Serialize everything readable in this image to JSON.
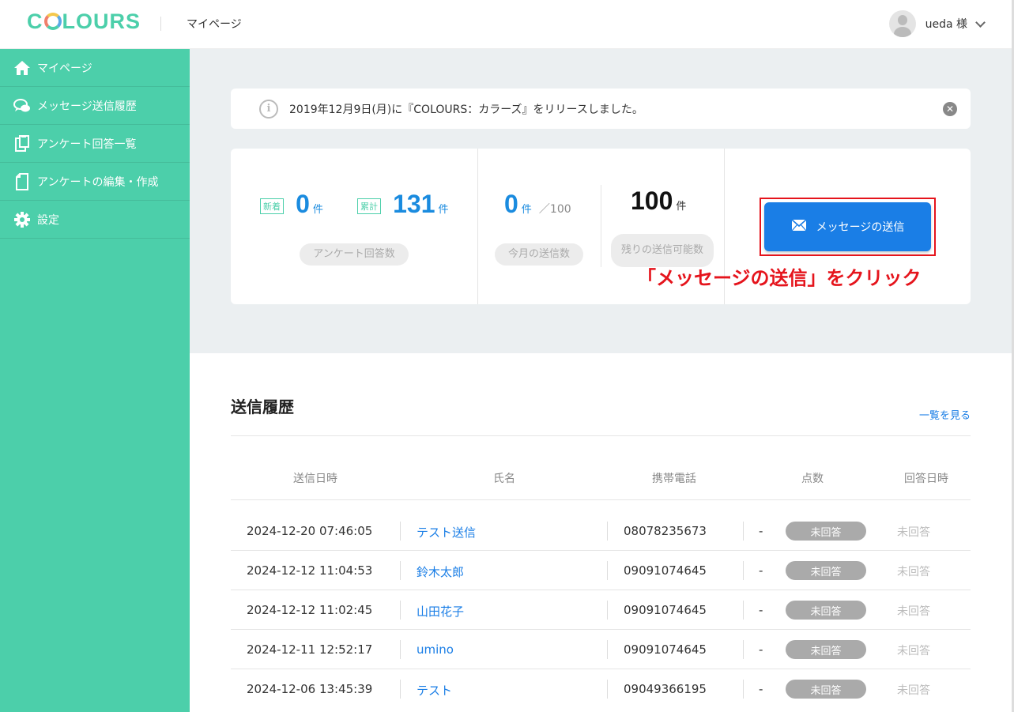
{
  "header": {
    "logo": "COLOURS",
    "title": "マイページ",
    "user": "ueda 様"
  },
  "sidebar": {
    "items": [
      {
        "label": "マイページ",
        "icon": "home-icon"
      },
      {
        "label": "メッセージ送信履歴",
        "icon": "chat-icon"
      },
      {
        "label": "アンケート回答一覧",
        "icon": "clipboard-icon"
      },
      {
        "label": "アンケートの編集・作成",
        "icon": "document-icon"
      },
      {
        "label": "設定",
        "icon": "gear-icon"
      }
    ]
  },
  "notice": {
    "text": "2019年12月9日(月)に『COLOURS：カラーズ』をリリースしました。"
  },
  "stats": {
    "new_tag": "新着",
    "new_value": "0",
    "new_unit": "件",
    "total_tag": "累計",
    "total_value": "131",
    "total_unit": "件",
    "answers_label": "アンケート回答数",
    "month_value": "0",
    "month_unit": "件",
    "month_limit": "／100",
    "month_label": "今月の送信数",
    "remaining_value": "100",
    "remaining_unit": "件",
    "remaining_label": "残りの送信可能数"
  },
  "send_button": {
    "label": "メッセージの送信",
    "annotation": "「メッセージの送信」をクリック"
  },
  "history": {
    "title": "送信履歴",
    "view_all": "一覧を見る",
    "columns": [
      "送信日時",
      "氏名",
      "携帯電話",
      "点数",
      "回答日時"
    ],
    "rows": [
      {
        "date": "2024-12-20 07:46:05",
        "name": "テスト送信",
        "phone": "08078235673",
        "score": "-",
        "status": "未回答",
        "answered": "未回答"
      },
      {
        "date": "2024-12-12 11:04:53",
        "name": "鈴木太郎",
        "phone": "09091074645",
        "score": "-",
        "status": "未回答",
        "answered": "未回答"
      },
      {
        "date": "2024-12-12 11:02:45",
        "name": "山田花子",
        "phone": "09091074645",
        "score": "-",
        "status": "未回答",
        "answered": "未回答"
      },
      {
        "date": "2024-12-11 12:52:17",
        "name": "umino",
        "phone": "09091074645",
        "score": "-",
        "status": "未回答",
        "answered": "未回答"
      },
      {
        "date": "2024-12-06 13:45:39",
        "name": "テスト",
        "phone": "09049366195",
        "score": "-",
        "status": "未回答",
        "answered": "未回答"
      }
    ]
  },
  "colors": {
    "sidebar": "#4ccfaa",
    "accent_blue": "#1a8bdf",
    "button_blue": "#1a7ee6",
    "annotation_red": "#e5141c"
  }
}
